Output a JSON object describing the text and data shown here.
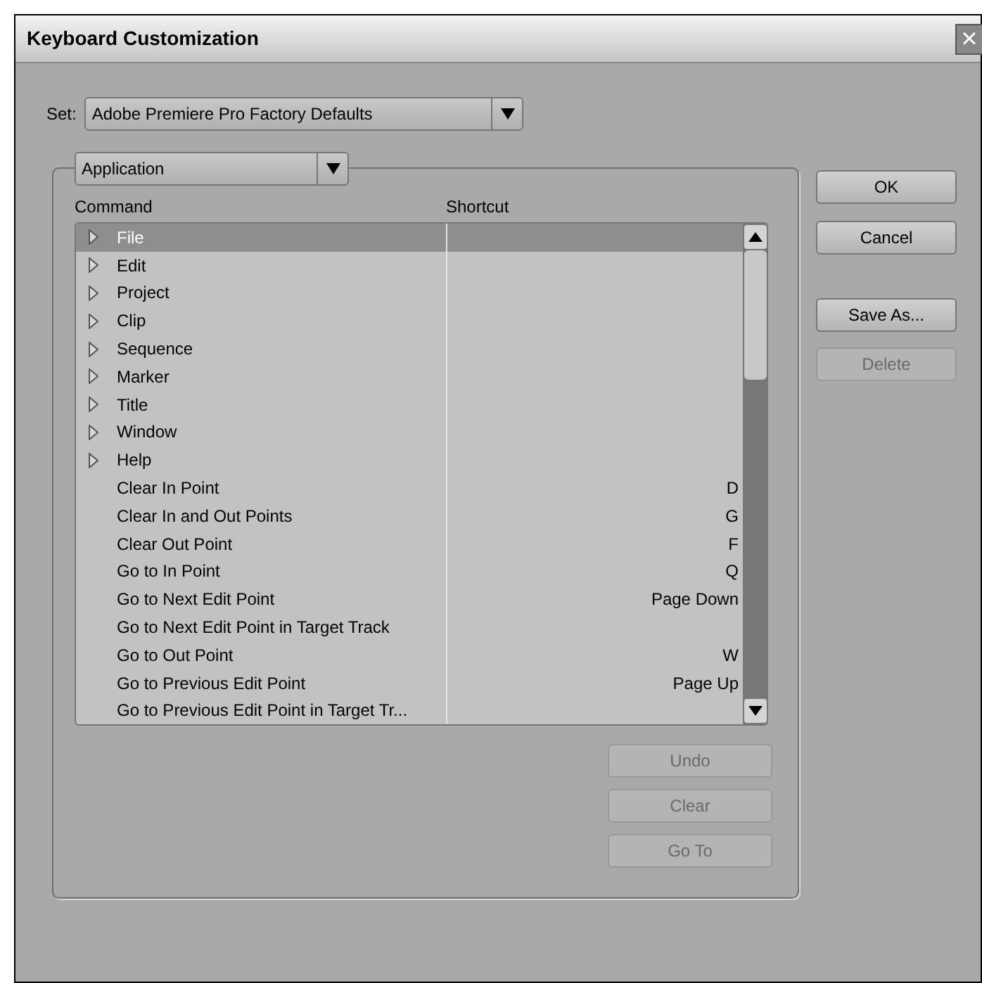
{
  "window": {
    "title": "Keyboard Customization",
    "close": "×"
  },
  "set": {
    "label": "Set:",
    "value": "Adobe Premiere Pro Factory Defaults"
  },
  "category": {
    "value": "Application"
  },
  "table": {
    "columns": [
      "Command",
      "Shortcut"
    ],
    "rows": [
      {
        "kind": "group",
        "command": "File",
        "shortcut": "",
        "selected": true
      },
      {
        "kind": "group",
        "command": "Edit",
        "shortcut": "",
        "selected": false
      },
      {
        "kind": "group",
        "command": "Project",
        "shortcut": "",
        "selected": false
      },
      {
        "kind": "group",
        "command": "Clip",
        "shortcut": "",
        "selected": false
      },
      {
        "kind": "group",
        "command": "Sequence",
        "shortcut": "",
        "selected": false
      },
      {
        "kind": "group",
        "command": "Marker",
        "shortcut": "",
        "selected": false
      },
      {
        "kind": "group",
        "command": "Title",
        "shortcut": "",
        "selected": false
      },
      {
        "kind": "group",
        "command": "Window",
        "shortcut": "",
        "selected": false
      },
      {
        "kind": "group",
        "command": "Help",
        "shortcut": "",
        "selected": false
      },
      {
        "kind": "command",
        "command": "Clear In Point",
        "shortcut": "D",
        "selected": false
      },
      {
        "kind": "command",
        "command": "Clear In and Out Points",
        "shortcut": "G",
        "selected": false
      },
      {
        "kind": "command",
        "command": "Clear Out Point",
        "shortcut": "F",
        "selected": false
      },
      {
        "kind": "command",
        "command": "Go to In Point",
        "shortcut": "Q",
        "selected": false
      },
      {
        "kind": "command",
        "command": "Go to Next Edit Point",
        "shortcut": "Page Down",
        "selected": false
      },
      {
        "kind": "command",
        "command": "Go to Next Edit Point in Target Track",
        "shortcut": "",
        "selected": false
      },
      {
        "kind": "command",
        "command": "Go to Out Point",
        "shortcut": "W",
        "selected": false
      },
      {
        "kind": "command",
        "command": "Go to Previous Edit Point",
        "shortcut": "Page Up",
        "selected": false
      },
      {
        "kind": "command",
        "command": "Go to Previous Edit Point in Target Tr...",
        "shortcut": "",
        "selected": false
      }
    ]
  },
  "list_buttons": [
    {
      "label": "Undo",
      "disabled": true
    },
    {
      "label": "Clear",
      "disabled": true
    },
    {
      "label": "Go To",
      "disabled": true
    }
  ],
  "buttons": [
    {
      "label": "OK",
      "disabled": false
    },
    {
      "label": "Cancel",
      "disabled": false
    },
    {
      "label": "Save As...",
      "disabled": false
    },
    {
      "label": "Delete",
      "disabled": true
    }
  ]
}
